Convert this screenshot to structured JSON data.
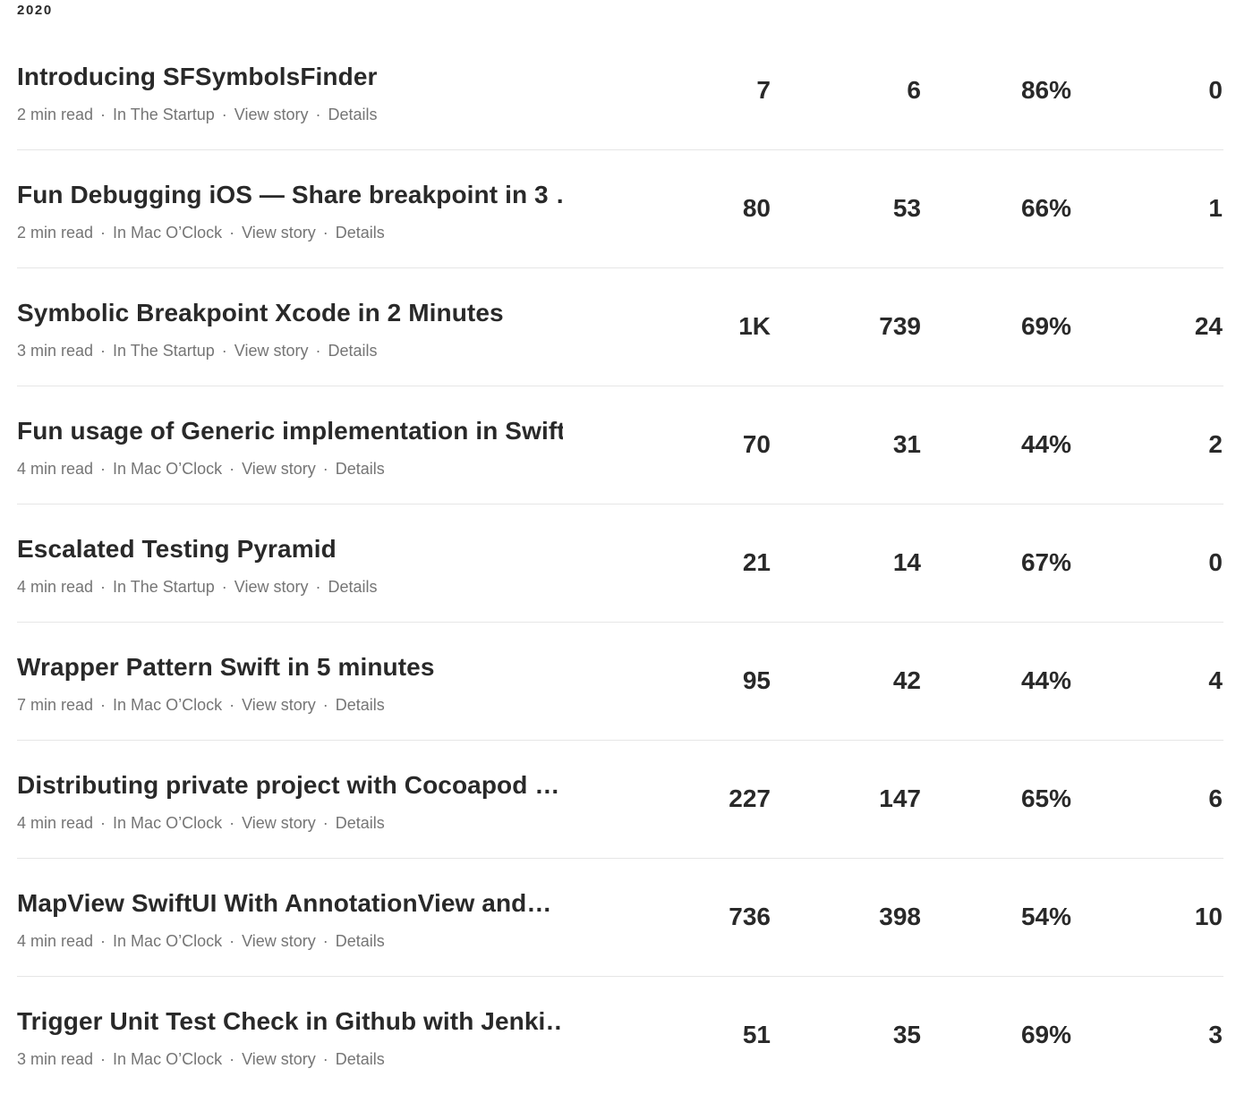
{
  "year": "2020",
  "stories": [
    {
      "title": "Introducing SFSymbolsFinder",
      "read_time": "2 min read",
      "publication": "In The Startup",
      "view_story": "View story",
      "details": "Details",
      "views": "7",
      "reads": "6",
      "read_ratio": "86%",
      "fans": "0"
    },
    {
      "title": "Fun Debugging iOS — Share breakpoint in 3 …",
      "read_time": "2 min read",
      "publication": "In Mac O’Clock",
      "view_story": "View story",
      "details": "Details",
      "views": "80",
      "reads": "53",
      "read_ratio": "66%",
      "fans": "1"
    },
    {
      "title": "Symbolic Breakpoint Xcode in 2 Minutes",
      "read_time": "3 min read",
      "publication": "In The Startup",
      "view_story": "View story",
      "details": "Details",
      "views": "1K",
      "reads": "739",
      "read_ratio": "69%",
      "fans": "24"
    },
    {
      "title": "Fun usage of Generic implementation in Swift",
      "read_time": "4 min read",
      "publication": "In Mac O’Clock",
      "view_story": "View story",
      "details": "Details",
      "views": "70",
      "reads": "31",
      "read_ratio": "44%",
      "fans": "2"
    },
    {
      "title": "Escalated Testing Pyramid",
      "read_time": "4 min read",
      "publication": "In The Startup",
      "view_story": "View story",
      "details": "Details",
      "views": "21",
      "reads": "14",
      "read_ratio": "67%",
      "fans": "0"
    },
    {
      "title": "Wrapper Pattern Swift in 5 minutes",
      "read_time": "7 min read",
      "publication": "In Mac O’Clock",
      "view_story": "View story",
      "details": "Details",
      "views": "95",
      "reads": "42",
      "read_ratio": "44%",
      "fans": "4"
    },
    {
      "title": "Distributing private project with Cocoapod …",
      "read_time": "4 min read",
      "publication": "In Mac O’Clock",
      "view_story": "View story",
      "details": "Details",
      "views": "227",
      "reads": "147",
      "read_ratio": "65%",
      "fans": "6"
    },
    {
      "title": "MapView SwiftUI With AnnotationView and…",
      "read_time": "4 min read",
      "publication": "In Mac O’Clock",
      "view_story": "View story",
      "details": "Details",
      "views": "736",
      "reads": "398",
      "read_ratio": "54%",
      "fans": "10"
    },
    {
      "title": "Trigger Unit Test Check in Github with Jenki…",
      "read_time": "3 min read",
      "publication": "In Mac O’Clock",
      "view_story": "View story",
      "details": "Details",
      "views": "51",
      "reads": "35",
      "read_ratio": "69%",
      "fans": "3"
    }
  ]
}
